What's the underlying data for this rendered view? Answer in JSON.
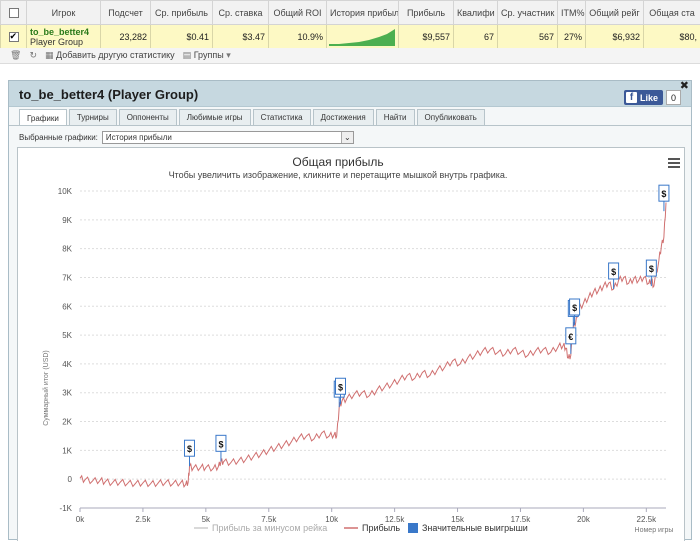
{
  "grid": {
    "headers": [
      "Игрок",
      "Подсчет",
      "Ср. прибыль",
      "Ср. ставка",
      "Общий ROI",
      "История прибыл",
      "Прибыль",
      "Квалифи",
      "Ср. участник",
      "ITM%",
      "Общий рейг",
      "Общая ста"
    ],
    "row": {
      "player_name": "to_be_better4",
      "player_group": "Player Group",
      "count": "23,282",
      "avg_profit": "$0.41",
      "avg_stake": "$3.47",
      "roi": "10.9%",
      "profit": "$9,557",
      "qualified": "67",
      "avg_entrants": "567",
      "itm": "27%",
      "total_rake": "$6,932",
      "total_stake": "$80,"
    }
  },
  "toolbar": {
    "add_stats": "Добавить другую статистику",
    "groups": "Группы"
  },
  "panel": {
    "title": "to_be_better4 (Player Group)",
    "fb_like": "Like",
    "fb_count": "0",
    "tabs": [
      "Графики",
      "Турниры",
      "Оппоненты",
      "Любимые игры",
      "Статистика",
      "Достижения",
      "Найти",
      "Опубликовать"
    ],
    "selected_charts_label": "Выбранные графики:",
    "selected_chart": "История прибыли"
  },
  "chart_data": {
    "type": "line",
    "title": "Общая прибыль",
    "subtitle": "Чтобы увеличить изображение, кликните и перетащите мышкой внутрь графика.",
    "ylabel": "Суммарный итог (USD)",
    "xlabel": "Номер игры",
    "xlim": [
      0,
      23282
    ],
    "ylim": [
      -1000,
      10000
    ],
    "x_ticks": [
      0,
      2500,
      5000,
      7500,
      10000,
      12500,
      15000,
      17500,
      20000,
      22500
    ],
    "x_tick_labels": [
      "0k",
      "2.5k",
      "5k",
      "7.5k",
      "10k",
      "12.5k",
      "15k",
      "17.5k",
      "20k",
      "22.5k"
    ],
    "y_ticks": [
      -1000,
      0,
      1000,
      2000,
      3000,
      4000,
      5000,
      6000,
      7000,
      8000,
      9000,
      10000
    ],
    "y_tick_labels": [
      "-1K",
      "0",
      "1K",
      "2K",
      "3K",
      "4K",
      "5K",
      "6K",
      "7K",
      "8K",
      "9K",
      "10K"
    ],
    "grid": true,
    "legend": "bottom",
    "legend_entries": [
      "Прибыль за минусом рейка",
      "Прибыль",
      "Значительные выигрыши"
    ],
    "series": [
      {
        "name": "Прибыль",
        "color": "#d07070",
        "x": [
          0,
          200,
          500,
          800,
          1000,
          1300,
          1600,
          1900,
          2200,
          2500,
          2800,
          3100,
          3400,
          3700,
          4000,
          4200,
          4300,
          4350,
          4500,
          4800,
          5000,
          5300,
          5500,
          5600,
          5700,
          6000,
          6300,
          6600,
          6900,
          7200,
          7500,
          7800,
          8100,
          8400,
          8700,
          9000,
          9300,
          9600,
          9900,
          10100,
          10200,
          10300,
          10400,
          10600,
          10900,
          11200,
          11500,
          11800,
          12100,
          12400,
          12700,
          13000,
          13300,
          13600,
          13900,
          14200,
          14500,
          14800,
          15100,
          15400,
          15700,
          16000,
          16300,
          16600,
          16900,
          17200,
          17500,
          17800,
          18100,
          18400,
          18700,
          19000,
          19200,
          19300,
          19400,
          19500,
          19600,
          19700,
          19800,
          20000,
          20200,
          20400,
          20600,
          20800,
          21000,
          21200,
          21400,
          21600,
          21800,
          22000,
          22200,
          22400,
          22600,
          22700,
          22800,
          23000,
          23100,
          23200,
          23282
        ],
        "y": [
          30,
          -20,
          -60,
          -40,
          -90,
          -120,
          -100,
          -140,
          -150,
          -130,
          -160,
          -140,
          -110,
          -150,
          -120,
          -180,
          -100,
          450,
          380,
          420,
          400,
          380,
          440,
          620,
          600,
          580,
          640,
          700,
          800,
          880,
          1000,
          1100,
          1200,
          1300,
          1450,
          1500,
          1400,
          1600,
          1500,
          1550,
          1500,
          2500,
          2700,
          2800,
          2950,
          3000,
          2900,
          3100,
          3200,
          3300,
          3450,
          3600,
          3500,
          3700,
          3600,
          3800,
          3900,
          4100,
          4000,
          4200,
          4300,
          4450,
          4500,
          4400,
          4350,
          4500,
          4400,
          4300,
          4450,
          4500,
          4400,
          4600,
          4650,
          4550,
          4200,
          4300,
          5300,
          5450,
          5900,
          6100,
          6300,
          6500,
          6550,
          6700,
          6800,
          6600,
          6900,
          7000,
          6800,
          6950,
          6900,
          7000,
          6800,
          6900,
          6700,
          7600,
          8100,
          8400,
          9600
        ]
      }
    ],
    "big_wins": [
      {
        "x": 4350,
        "y": 450,
        "label": "$"
      },
      {
        "x": 5600,
        "y": 620,
        "label": "$"
      },
      {
        "x": 10300,
        "y": 2500,
        "label": "$"
      },
      {
        "x": 10350,
        "y": 2600,
        "label": "$"
      },
      {
        "x": 19500,
        "y": 4350,
        "label": "€"
      },
      {
        "x": 19600,
        "y": 5300,
        "label": "$"
      },
      {
        "x": 19650,
        "y": 5350,
        "label": "$"
      },
      {
        "x": 21200,
        "y": 6600,
        "label": "$"
      },
      {
        "x": 22700,
        "y": 6700,
        "label": "$"
      },
      {
        "x": 23200,
        "y": 9300,
        "label": "$"
      }
    ],
    "colors": {
      "profit": "#d07070",
      "profit_no_rake": "#cccccc",
      "big_wins": "#3a78c9"
    }
  }
}
